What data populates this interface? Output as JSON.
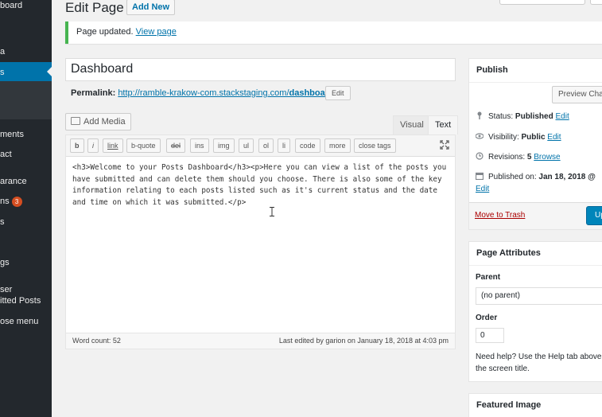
{
  "sidebar": {
    "items": [
      {
        "label": "board"
      },
      {
        "label": "a"
      },
      {
        "label": "s"
      },
      {
        "label": "ments"
      },
      {
        "label": "act"
      },
      {
        "label": "arance"
      },
      {
        "label": "ns"
      },
      {
        "label": "s"
      },
      {
        "label": "gs"
      },
      {
        "label": "ser"
      },
      {
        "label": "itted Posts"
      },
      {
        "label": "ose menu"
      }
    ],
    "update_count": "3"
  },
  "header": {
    "title": "Edit Page",
    "add_new": "Add New"
  },
  "notice": {
    "text": "Page updated.",
    "link": "View page"
  },
  "post": {
    "title": "Dashboard",
    "permalink_label": "Permalink:",
    "permalink_base": "http://ramble-krakow-com.stackstaging.com/",
    "permalink_slug": "dashboard",
    "permalink_end": "/",
    "edit_label": "Edit"
  },
  "editor": {
    "add_media": "Add Media",
    "tab_visual": "Visual",
    "tab_text": "Text",
    "toolbar": [
      "b",
      "i",
      "link",
      "b-quote",
      "del",
      "ins",
      "img",
      "ul",
      "ol",
      "li",
      "code",
      "more",
      "close tags"
    ],
    "content": "<h3>Welcome to your Posts Dashboard</h3><p>Here you can view a list of the posts you have submitted and can delete them should you choose. There is also some of the key information relating to each posts listed such as it's current status and the date and time on which it was submitted.</p>",
    "word_count": "Word count: 52",
    "last_edited": "Last edited by garion on January 18, 2018 at 4:03 pm"
  },
  "publish": {
    "title": "Publish",
    "preview": "Preview Cha",
    "status_label": "Status:",
    "status_value": "Published",
    "visibility_label": "Visibility:",
    "visibility_value": "Public",
    "revisions_label": "Revisions:",
    "revisions_value": "5",
    "browse": "Browse",
    "published_label": "Published on:",
    "published_value": "Jan 18, 2018 @",
    "edit": "Edit",
    "trash": "Move to Trash",
    "update": "Up"
  },
  "attributes": {
    "title": "Page Attributes",
    "parent_label": "Parent",
    "parent_value": "(no parent)",
    "order_label": "Order",
    "order_value": "0",
    "help": "Need help? Use the Help tab above the screen title."
  },
  "featured": {
    "title": "Featured Image"
  }
}
